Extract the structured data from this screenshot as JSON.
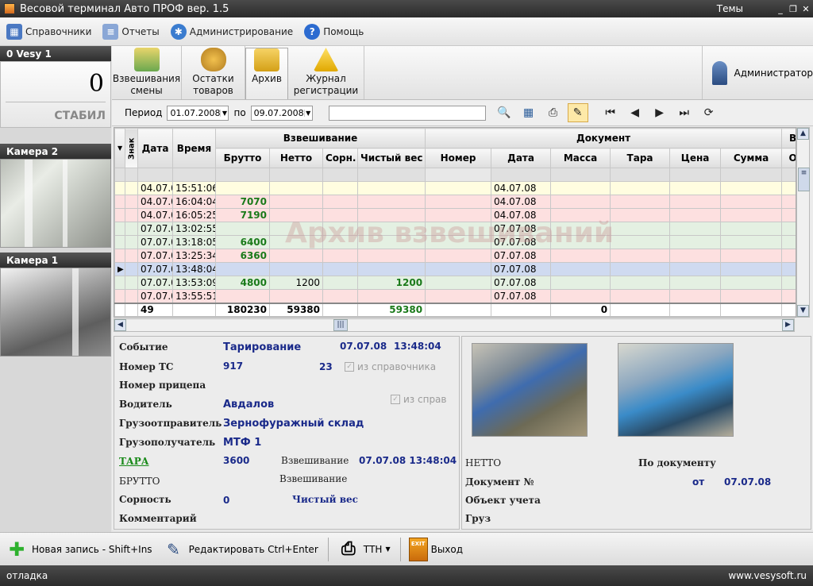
{
  "window": {
    "title": "Весовой терминал Авто ПРОФ вер. 1.5",
    "themes": "Темы",
    "min": "_",
    "restore": "❐",
    "close": "✕"
  },
  "menu": [
    {
      "label": "Справочники"
    },
    {
      "label": "Отчеты"
    },
    {
      "label": "Администрирование"
    },
    {
      "label": "Помощь"
    }
  ],
  "scale": {
    "title": "0 Vesy 1",
    "value": "0",
    "status": "СТАБИЛ"
  },
  "cameras": {
    "cam2": "Камера 2",
    "cam1": "Камера 1"
  },
  "ribbon": {
    "b1": [
      "Взвешивания",
      "смены"
    ],
    "b2": [
      "Остатки",
      "товаров"
    ],
    "b3": "Архив",
    "b4": [
      "Журнал",
      "регистрации"
    ],
    "user": "Администратор"
  },
  "filter": {
    "period_label": "Период",
    "from": "01.07.2008",
    "to_label": "по",
    "to": "09.07.2008"
  },
  "grid": {
    "group_weigh": "Взвешивание",
    "group_doc": "Документ",
    "group_extra": "Вз",
    "h_sign": "Знак",
    "h_date": "Дата",
    "h_time": "Время",
    "h_brutto": "Брутто",
    "h_netto": "Нетто",
    "h_sorn": "Сорн.",
    "h_clean": "Чистый вес",
    "h_dnum": "Номер",
    "h_ddate": "Дата",
    "h_dmass": "Масса",
    "h_dtara": "Тара",
    "h_dprice": "Цена",
    "h_dsum": "Сумма",
    "h_extra": "От",
    "rows": [
      {
        "cls": "y",
        "date": "04.07.0",
        "time": "15:51:06",
        "brutto": "",
        "netto": "",
        "clean": "",
        "ddate": "04.07.08"
      },
      {
        "cls": "p",
        "date": "04.07.0",
        "time": "16:04:04",
        "brutto": "7070",
        "netto": "",
        "clean": "",
        "ddate": "04.07.08"
      },
      {
        "cls": "p",
        "date": "04.07.0",
        "time": "16:05:25",
        "brutto": "7190",
        "netto": "",
        "clean": "",
        "ddate": "04.07.08"
      },
      {
        "cls": "g",
        "date": "07.07.0",
        "time": "13:02:55",
        "brutto": "",
        "netto": "",
        "clean": "",
        "ddate": "07.07.08"
      },
      {
        "cls": "g",
        "date": "07.07.0",
        "time": "13:18:05",
        "brutto": "6400",
        "netto": "",
        "clean": "",
        "ddate": "07.07.08"
      },
      {
        "cls": "p",
        "date": "07.07.0",
        "time": "13:25:34",
        "brutto": "6360",
        "netto": "",
        "clean": "",
        "ddate": "07.07.08"
      },
      {
        "cls": "b",
        "date": "07.07.0",
        "time": "13:48:04",
        "brutto": "",
        "netto": "",
        "clean": "",
        "ddate": "07.07.08"
      },
      {
        "cls": "g",
        "date": "07.07.0",
        "time": "13:53:09",
        "brutto": "4800",
        "netto": "1200",
        "clean": "1200",
        "ddate": "07.07.08"
      },
      {
        "cls": "p",
        "date": "07.07.0",
        "time": "13:55:51",
        "brutto": "",
        "netto": "",
        "clean": "",
        "ddate": "07.07.08"
      }
    ],
    "totals": {
      "count": "49",
      "brutto": "180230",
      "netto": "59380",
      "clean": "59380",
      "mass": "0"
    },
    "watermark": "Архив взвешиваний"
  },
  "detail": {
    "event_l": "Событие",
    "event_v": "Тарирование",
    "event_date": "07.07.08",
    "event_time": "13:48:04",
    "ts_l": "Номер ТС",
    "ts_v": "917",
    "ts_n": "23",
    "ts_chk": "из справочника",
    "trailer_l": "Номер прицепа",
    "driver_l": "Водитель",
    "driver_v": "Авдалов",
    "driver_chk": "из справ",
    "sender_l": "Грузоотправитель",
    "sender_v": "Зернофуражный склад",
    "receiver_l": "Грузополучатель",
    "receiver_v": "МТФ 1",
    "tara_l": "ТАРА",
    "tara_v": "3600",
    "tara_w": "Взвешивание",
    "tara_dt": "07.07.08 13:48:04",
    "brutto_l": "БРУТТО",
    "brutto_w": "Взвешивание",
    "sorn_l": "Сорность",
    "sorn_v": "0",
    "clean_l": "Чистый вес",
    "comment_l": "Комментарий",
    "netto_l": "НЕТТО",
    "bydoc_l": "По документу",
    "docnum_l": "Документ №",
    "doc_ot": "от",
    "doc_date": "07.07.08",
    "obj_l": "Объект учета",
    "cargo_l": "Груз"
  },
  "bottom": {
    "new": "Новая запись - Shift+Ins",
    "edit": "Редактировать Ctrl+Enter",
    "ttn": "ТТН",
    "exit": "Выход",
    "exit_icon": "EXIT"
  },
  "status": {
    "left": "отладка",
    "right": "www.vesysoft.ru"
  }
}
